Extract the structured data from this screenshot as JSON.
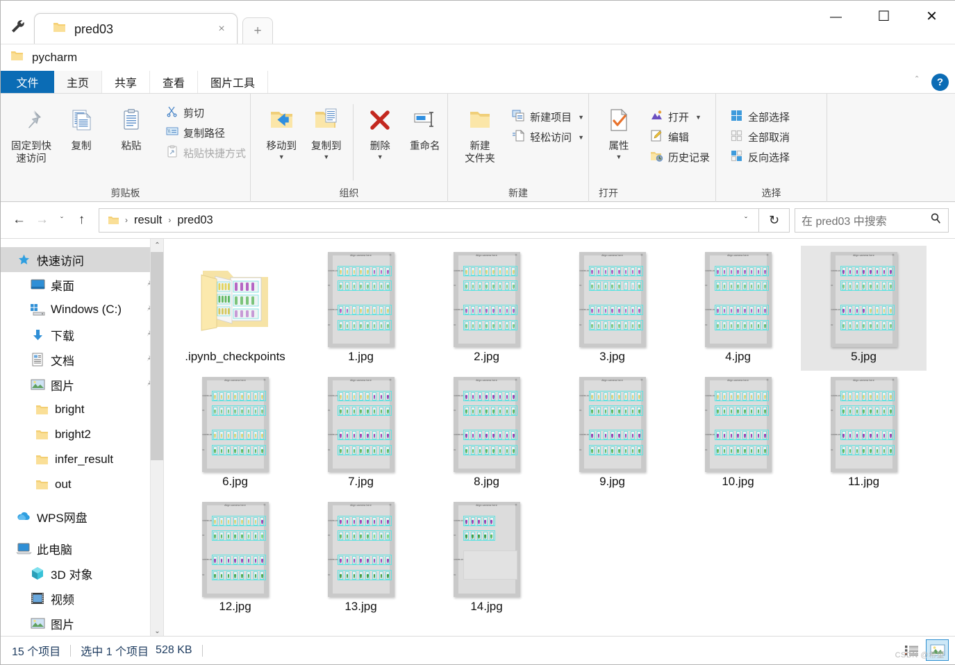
{
  "window": {
    "tab_title": "pred03",
    "folder_name": "pycharm",
    "qat_icon": "wrench-icon",
    "tab_close_glyph": "×",
    "new_tab_glyph": "+",
    "minimize_glyph": "—",
    "maximize_glyph": "☐",
    "close_glyph": "✕"
  },
  "ribbon_tabs": {
    "file": "文件",
    "home": "主页",
    "share": "共享",
    "view": "查看",
    "picture_tools": "图片工具",
    "collapse_glyph": "＾",
    "help_glyph": "?"
  },
  "ribbon": {
    "groups": [
      {
        "title": "剪贴板",
        "big": [
          {
            "label": "固定到快\n速访问",
            "icon": "pin-icon"
          },
          {
            "label": "复制",
            "icon": "copy-icon"
          },
          {
            "label": "粘贴",
            "icon": "paste-icon"
          }
        ],
        "small": [
          {
            "label": "剪切",
            "icon": "scissors-icon",
            "dim": false
          },
          {
            "label": "复制路径",
            "icon": "copy-path-icon",
            "dim": false
          },
          {
            "label": "粘贴快捷方式",
            "icon": "paste-shortcut-icon",
            "dim": true
          }
        ]
      },
      {
        "title": "组织",
        "big": [
          {
            "label": "移动到",
            "icon": "move-to-icon",
            "caret": true
          },
          {
            "label": "复制到",
            "icon": "copy-to-icon",
            "caret": true
          },
          {
            "label": "删除",
            "icon": "delete-icon",
            "caret": true
          },
          {
            "label": "重命名",
            "icon": "rename-icon",
            "caret": false
          }
        ],
        "small": []
      },
      {
        "title": "新建",
        "big": [
          {
            "label": "新建\n文件夹",
            "icon": "new-folder-icon"
          }
        ],
        "small": [
          {
            "label": "新建项目",
            "icon": "new-item-icon",
            "caret": true
          },
          {
            "label": "轻松访问",
            "icon": "easy-access-icon",
            "caret": true
          }
        ]
      },
      {
        "title": "打开",
        "big": [
          {
            "label": "属性",
            "icon": "properties-icon",
            "caret": true
          }
        ],
        "small": [
          {
            "label": "打开",
            "icon": "open-icon",
            "caret": true
          },
          {
            "label": "编辑",
            "icon": "edit-icon"
          },
          {
            "label": "历史记录",
            "icon": "history-icon"
          }
        ]
      },
      {
        "title": "选择",
        "big": [],
        "small": [
          {
            "label": "全部选择",
            "icon": "select-all-icon"
          },
          {
            "label": "全部取消",
            "icon": "select-none-icon"
          },
          {
            "label": "反向选择",
            "icon": "invert-selection-icon"
          }
        ]
      }
    ]
  },
  "address": {
    "back_glyph": "←",
    "forward_glyph": "→",
    "recent_glyph": "ˇ",
    "up_glyph": "↑",
    "crumbs": [
      "result",
      "pred03"
    ],
    "crumb_sep": "›",
    "dropdown_glyph": "ˇ",
    "refresh_glyph": "↻",
    "search_placeholder": "在 pred03 中搜索",
    "search_value": "",
    "search_icon": "magnifier-icon"
  },
  "sidebar": {
    "items": [
      {
        "label": "快速访问",
        "icon": "quick-access-star-icon",
        "indent": 0,
        "selected": true,
        "pinned": false
      },
      {
        "label": "桌面",
        "icon": "desktop-icon",
        "indent": 1,
        "selected": false,
        "pinned": true
      },
      {
        "label": "Windows (C:)",
        "icon": "drive-icon",
        "indent": 1,
        "selected": false,
        "pinned": true
      },
      {
        "label": "下载",
        "icon": "downloads-icon",
        "indent": 1,
        "selected": false,
        "pinned": true
      },
      {
        "label": "文档",
        "icon": "documents-icon",
        "indent": 1,
        "selected": false,
        "pinned": true
      },
      {
        "label": "图片",
        "icon": "pictures-icon",
        "indent": 1,
        "selected": false,
        "pinned": true
      },
      {
        "label": "bright",
        "icon": "folder-icon",
        "indent": 1,
        "selected": false,
        "pinned": false
      },
      {
        "label": "bright2",
        "icon": "folder-icon",
        "indent": 1,
        "selected": false,
        "pinned": false
      },
      {
        "label": "infer_result",
        "icon": "folder-icon",
        "indent": 1,
        "selected": false,
        "pinned": false
      },
      {
        "label": "out",
        "icon": "folder-icon",
        "indent": 1,
        "selected": false,
        "pinned": false
      },
      {
        "label": "WPS网盘",
        "icon": "wps-cloud-icon",
        "indent": 0,
        "selected": false,
        "pinned": false,
        "gap_before": true
      },
      {
        "label": "此电脑",
        "icon": "this-pc-icon",
        "indent": 0,
        "selected": false,
        "pinned": false,
        "gap_before": true
      },
      {
        "label": "3D 对象",
        "icon": "3d-objects-icon",
        "indent": 1,
        "selected": false,
        "pinned": false
      },
      {
        "label": "视频",
        "icon": "videos-icon",
        "indent": 1,
        "selected": false,
        "pinned": false
      },
      {
        "label": "图片",
        "icon": "pictures-icon",
        "indent": 1,
        "selected": false,
        "pinned": false
      }
    ],
    "scroll_up_glyph": "⌃",
    "scroll_down_glyph": "⌄"
  },
  "files": {
    "items": [
      {
        "name": ".ipynb_checkpoints",
        "type": "folder",
        "selected": false
      },
      {
        "name": "1.jpg",
        "type": "image",
        "selected": false
      },
      {
        "name": "2.jpg",
        "type": "image",
        "selected": false
      },
      {
        "name": "3.jpg",
        "type": "image",
        "selected": false
      },
      {
        "name": "4.jpg",
        "type": "image",
        "selected": false
      },
      {
        "name": "5.jpg",
        "type": "image",
        "selected": true
      },
      {
        "name": "6.jpg",
        "type": "image",
        "selected": false
      },
      {
        "name": "7.jpg",
        "type": "image",
        "selected": false
      },
      {
        "name": "8.jpg",
        "type": "image",
        "selected": false
      },
      {
        "name": "9.jpg",
        "type": "image",
        "selected": false
      },
      {
        "name": "10.jpg",
        "type": "image",
        "selected": false
      },
      {
        "name": "11.jpg",
        "type": "image",
        "selected": false
      },
      {
        "name": "12.jpg",
        "type": "image",
        "selected": false
      },
      {
        "name": "13.jpg",
        "type": "image",
        "selected": false
      },
      {
        "name": "14.jpg",
        "type": "image",
        "selected": false
      }
    ],
    "thumbnail_caption": "Align camera here",
    "thumbnail_row_labels": [
      "COVID-19",
      "IC",
      "COVID-19",
      "IC"
    ]
  },
  "status": {
    "item_count": "15 个项目",
    "selection": "选中 1 个项目",
    "size": "528 KB",
    "view_details_icon": "details-view-icon",
    "view_large_icons_icon": "large-icons-view-icon",
    "watermark": "CSDN @希望"
  },
  "colors": {
    "accent": "#0b6cb5",
    "selection": "#e6e6e6",
    "nav_selection": "#d8d8d8",
    "folder": "#f7d98c",
    "status_text": "#1c3a5e",
    "view_active": "#cde8f7"
  }
}
